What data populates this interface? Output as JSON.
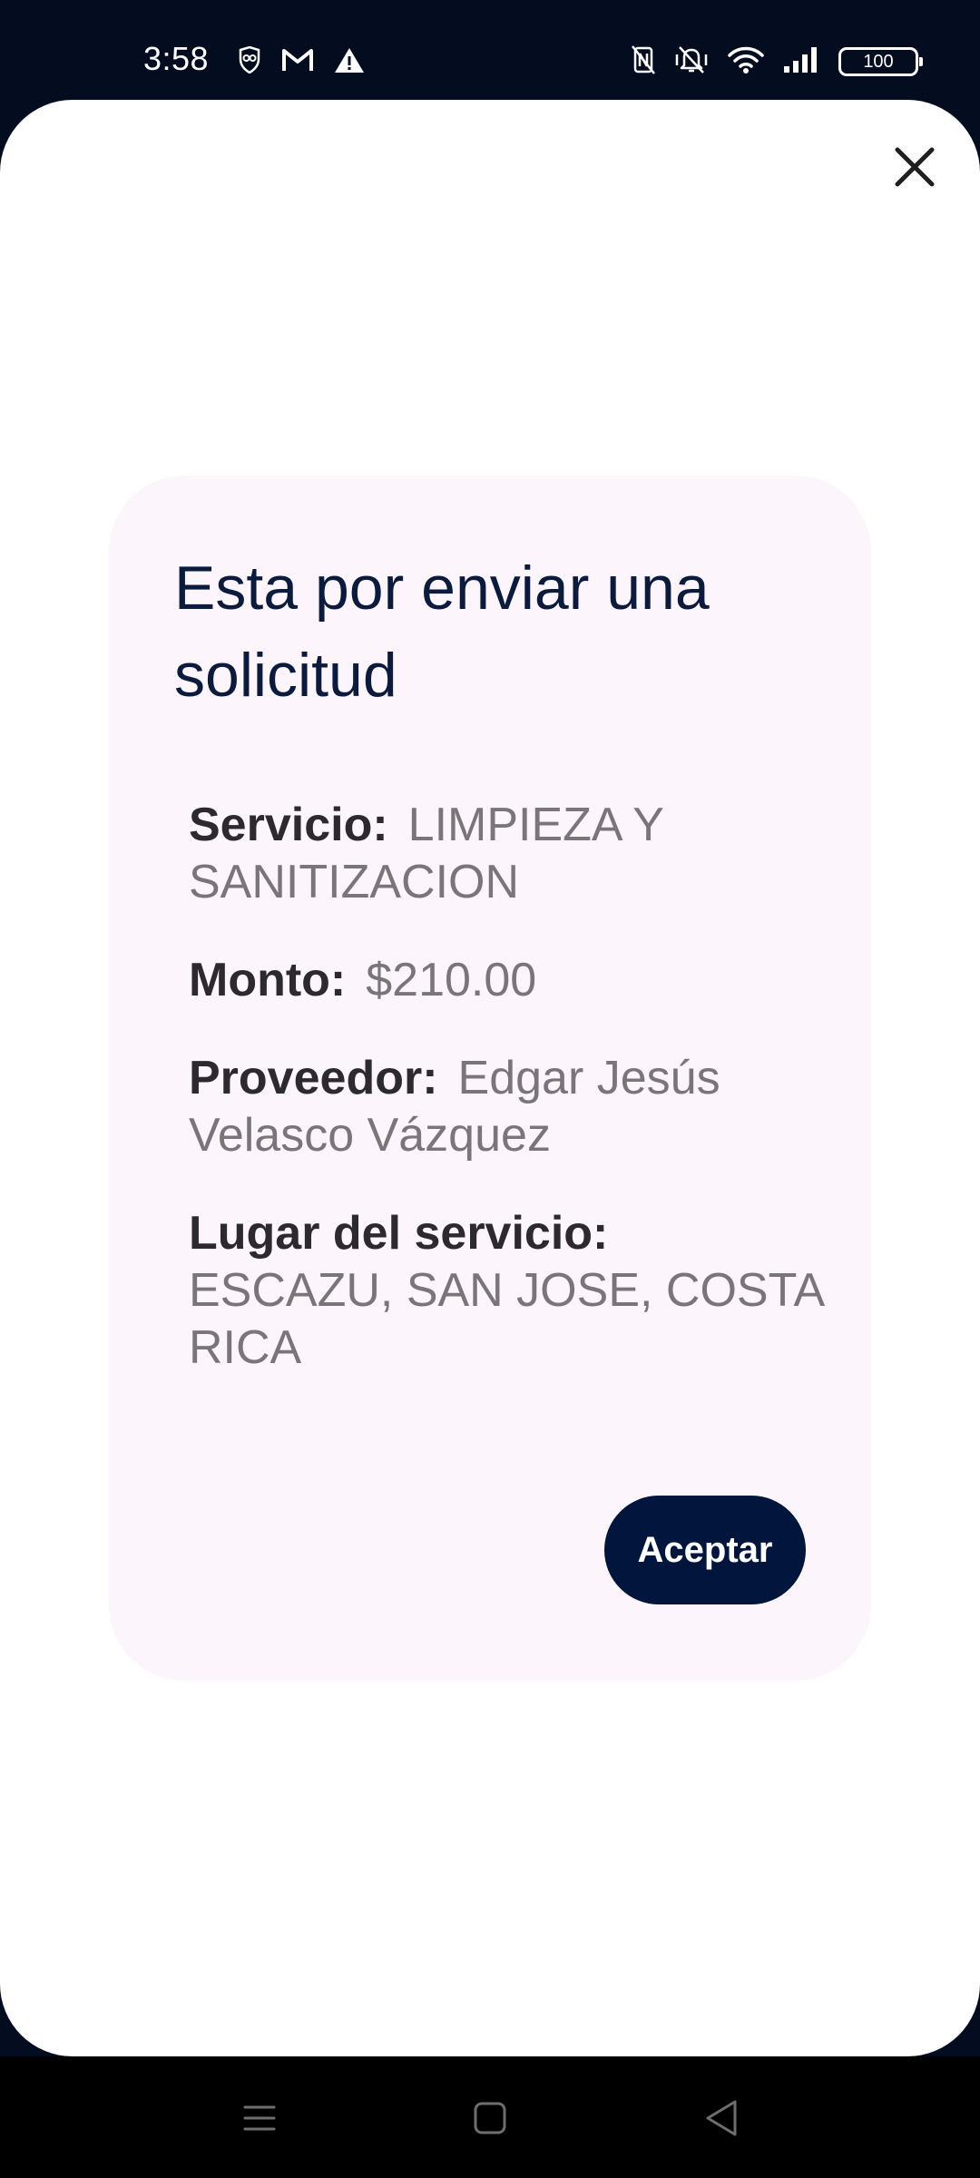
{
  "status_bar": {
    "time": "3:58",
    "battery": "100",
    "left_icons": [
      "privacy-icon",
      "gmail-icon",
      "alert-icon"
    ],
    "right_icons": [
      "nfc-off-icon",
      "vibrate-off-icon",
      "wifi-icon",
      "signal-icon",
      "battery-icon"
    ]
  },
  "dialog": {
    "title": "Esta por enviar una solicitud",
    "fields": [
      {
        "label": "Servicio:",
        "value": "LIMPIEZA Y SANITIZACION"
      },
      {
        "label": "Monto:",
        "value": "$210.00"
      },
      {
        "label": "Proveedor:",
        "value": "Edgar Jesús Velasco Vázquez"
      },
      {
        "label": "Lugar del servicio:",
        "value": "ESCAZU, SAN JOSE, COSTA RICA"
      }
    ],
    "accept_label": "Aceptar"
  },
  "colors": {
    "status_bar_bg": "#030d1f",
    "dialog_bg": "#fcf5fc",
    "title": "#0b1b3d",
    "label": "#2c2a2e",
    "value": "#7a7579",
    "accept_button_bg": "#02163d"
  },
  "nav_bar": {
    "items": [
      "menu-icon",
      "home-icon",
      "back-icon"
    ]
  }
}
